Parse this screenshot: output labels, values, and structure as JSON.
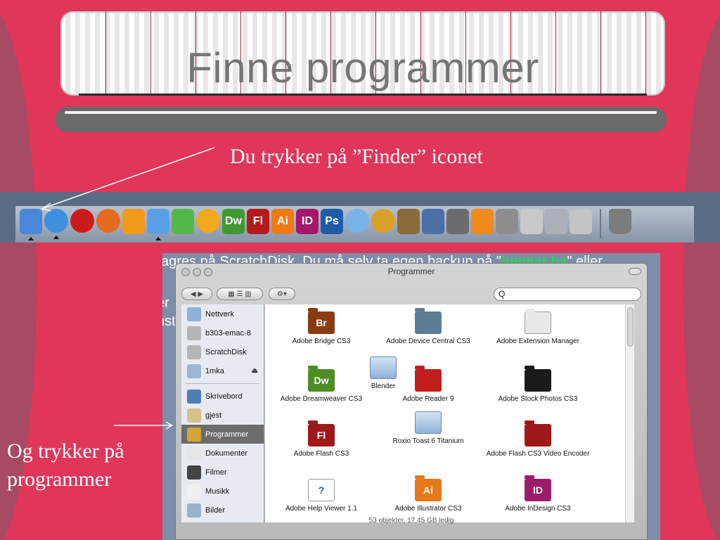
{
  "slide": {
    "title": "Finne programmer",
    "caption_top": "Du trykker på ”Finder” iconet",
    "caption_left": "Og trykker på programmer"
  },
  "dock": {
    "icons": [
      {
        "name": "finder-icon",
        "label": "",
        "color": "#4a87d8"
      },
      {
        "name": "safari-icon",
        "label": "",
        "color": "#3e8fe0"
      },
      {
        "name": "opera-icon",
        "label": "",
        "color": "#cc1b1b"
      },
      {
        "name": "firefox-icon",
        "label": "",
        "color": "#e76b1f"
      },
      {
        "name": "pages-icon",
        "label": "",
        "color": "#f29a1c"
      },
      {
        "name": "keynote-icon",
        "label": "",
        "color": "#5aa0e8"
      },
      {
        "name": "numbers-icon",
        "label": "",
        "color": "#54b848"
      },
      {
        "name": "swf-icon",
        "label": "",
        "color": "#f2a91b"
      },
      {
        "name": "dreamweaver-icon",
        "label": "Dw",
        "color": "#3f9a32"
      },
      {
        "name": "flash-icon",
        "label": "Fl",
        "color": "#b51a1a"
      },
      {
        "name": "illustrator-icon",
        "label": "Ai",
        "color": "#f07b14"
      },
      {
        "name": "indesign-icon",
        "label": "ID",
        "color": "#a3186a"
      },
      {
        "name": "photoshop-icon",
        "label": "Ps",
        "color": "#1e5ca8"
      },
      {
        "name": "itunes-icon",
        "label": "",
        "color": "#7ab3e8"
      },
      {
        "name": "toast-icon",
        "label": "",
        "color": "#d9a12c"
      },
      {
        "name": "iphoto-icon",
        "label": "",
        "color": "#8a6b3a"
      },
      {
        "name": "imovie-icon",
        "label": "",
        "color": "#4b6fa6"
      },
      {
        "name": "clapper-icon",
        "label": "",
        "color": "#6c6c6c"
      },
      {
        "name": "blender-icon",
        "label": "",
        "color": "#f08a1c"
      },
      {
        "name": "utility-icon",
        "label": "",
        "color": "#8d8d8d"
      },
      {
        "name": "lock-icon",
        "label": "",
        "color": "#c9c9c9"
      },
      {
        "name": "preview-icon",
        "label": "",
        "color": "#aab0b8"
      },
      {
        "name": "system-preferences-icon",
        "label": "",
        "color": "#c4c4c4"
      }
    ],
    "trash": "trash-icon"
  },
  "background_text": {
    "line1_before": "agres på ScratchDisk. Du må selv ta egen backup på \"",
    "line1_green": "hiemar.ba",
    "line1_after": "\" eller",
    "frag1": "er",
    "frag2": "nst"
  },
  "finder": {
    "window_title": "Programmer",
    "search_value": "",
    "search_icon": "Q",
    "sidebar": [
      {
        "label": "Nettverk",
        "icon": "network-icon"
      },
      {
        "label": "b303-emac-8",
        "icon": "disk-icon"
      },
      {
        "label": "ScratchDisk",
        "icon": "disk-icon"
      },
      {
        "label": "1mka",
        "icon": "network-volume-icon",
        "eject": "⏏"
      },
      {
        "label": "Skrivebord",
        "icon": "desktop-icon"
      },
      {
        "label": "gjest",
        "icon": "home-icon"
      },
      {
        "label": "Programmer",
        "icon": "applications-icon",
        "selected": true
      },
      {
        "label": "Dokumenter",
        "icon": "documents-icon"
      },
      {
        "label": "Filmer",
        "icon": "movies-icon"
      },
      {
        "label": "Musikk",
        "icon": "music-icon"
      },
      {
        "label": "Bilder",
        "icon": "pictures-icon"
      }
    ],
    "items": [
      {
        "label": "Adobe Bridge CS3",
        "badge": "Br",
        "color": "#8a3b12"
      },
      {
        "label": "Adobe Device Central CS3",
        "badge": "",
        "color": "#5b7d96"
      },
      {
        "label": "Adobe Extension Manager",
        "badge": "",
        "color": "#e8e8e8"
      },
      {
        "label": "Blender",
        "badge": "",
        "color": "folder"
      },
      {
        "label": "Adobe Dreamweaver CS3",
        "badge": "Dw",
        "color": "#4e8c24"
      },
      {
        "label": "Adobe Reader 9",
        "badge": "",
        "color": "#c21d1d"
      },
      {
        "label": "Adobe Stock Photos CS3",
        "badge": "",
        "color": "#1a1a1a"
      },
      {
        "label": "Adobe Flash CS3",
        "badge": "Fl",
        "color": "#9e1a1a"
      },
      {
        "label": "Roxio Toast 6 Titanium",
        "badge": "",
        "color": "folder"
      },
      {
        "label": "Adobe Flash CS3 Video Encoder",
        "badge": "",
        "color": "#a01818"
      },
      {
        "label": "Adobe Help Viewer 1.1",
        "badge": "?",
        "color": "#ffffff"
      },
      {
        "label": "Adobe Illustrator CS3",
        "badge": "Ai",
        "color": "#e8791a"
      },
      {
        "label": "Adobe InDesign CS3",
        "badge": "ID",
        "color": "#9b1d6a"
      }
    ],
    "status": "53 objekter, 17,45 GB ledig"
  }
}
